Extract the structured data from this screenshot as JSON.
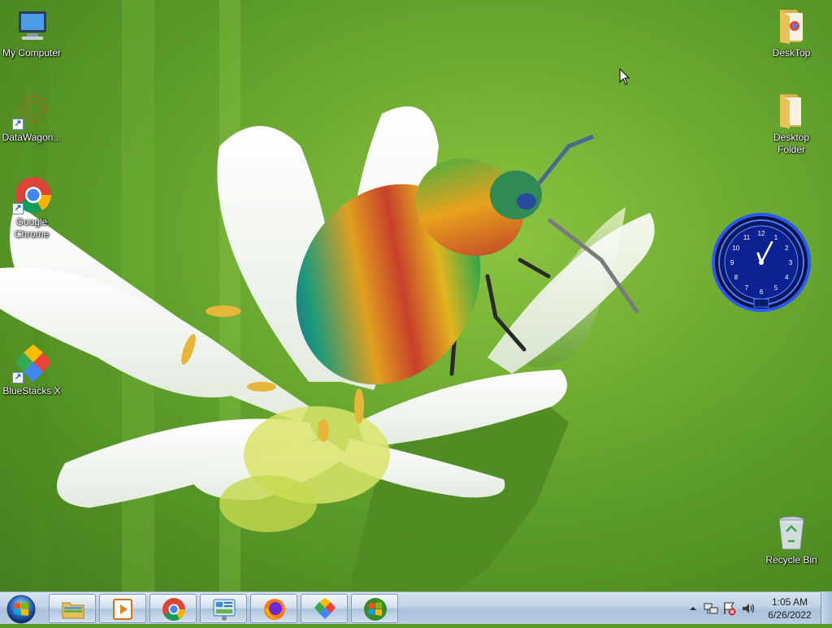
{
  "desktop": {
    "icons_left": [
      {
        "label": "My Computer",
        "icon": "computer-icon",
        "shortcut": false
      },
      {
        "label": "DataWagon...",
        "icon": "datawagon-icon",
        "shortcut": true
      },
      {
        "label": "Google Chrome",
        "icon": "chrome-icon",
        "shortcut": true
      },
      {
        "label": "BlueStacks X",
        "icon": "bluestacks-icon",
        "shortcut": true
      }
    ],
    "icons_right": [
      {
        "label": "DeskTop",
        "icon": "folder-icon"
      },
      {
        "label": "Desktop Folder",
        "icon": "folder-icon"
      },
      {
        "label": "Recycle Bin",
        "icon": "recycle-bin-icon"
      }
    ],
    "wallpaper": "beetle-on-white-flower",
    "clock_gadget": {
      "hour_numbers": [
        "12",
        "1",
        "2",
        "3",
        "4",
        "5",
        "6",
        "7",
        "8",
        "9",
        "10",
        "11"
      ],
      "color": "#1a4cff"
    }
  },
  "taskbar": {
    "start_button": "windows-start-icon",
    "pinned": [
      {
        "name": "file-explorer",
        "icon": "folder-icon"
      },
      {
        "name": "media-player",
        "icon": "media-player-icon"
      },
      {
        "name": "google-chrome",
        "icon": "chrome-icon"
      },
      {
        "name": "control-panel",
        "icon": "control-panel-icon"
      },
      {
        "name": "firefox",
        "icon": "firefox-icon"
      },
      {
        "name": "bluestacks",
        "icon": "bluestacks-icon"
      },
      {
        "name": "windows-update",
        "icon": "windows-logo-icon"
      }
    ],
    "tray": {
      "time": "1:05 AM",
      "date": "6/26/2022",
      "icons": [
        "show-hidden-icons",
        "network-icon",
        "action-center-icon",
        "volume-icon"
      ]
    }
  },
  "colors": {
    "taskbar": "#bfd2e6",
    "wallpaper_green": "#5a9a2a",
    "accent_blue": "#1a4cff"
  }
}
